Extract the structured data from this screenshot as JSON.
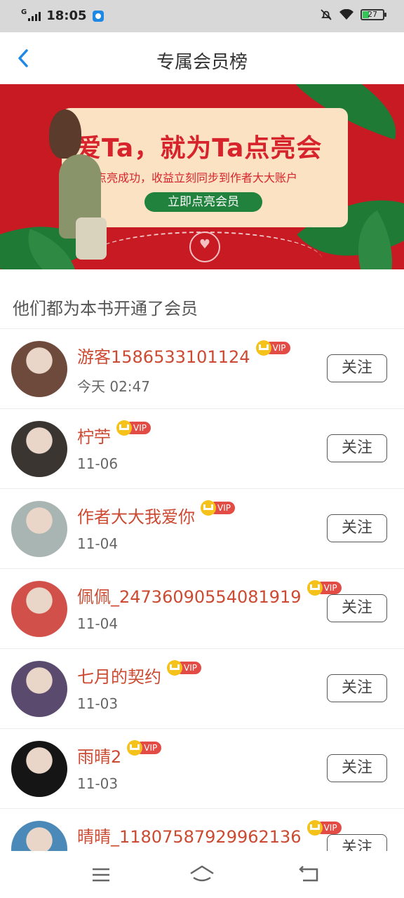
{
  "status_bar": {
    "time": "18:05",
    "signal_label": "G",
    "battery": "27"
  },
  "header": {
    "title": "专属会员榜"
  },
  "banner": {
    "headline": "爱Ta，就为Ta点亮会员",
    "subtitle": "点亮成功，收益立刻同步到作者大大账户",
    "button": "立即点亮会员"
  },
  "section": {
    "title": "他们都为本书开通了会员"
  },
  "members": [
    {
      "name": "游客1586533101124",
      "badge": "VIP",
      "time": "今天 02:47",
      "follow": "关注",
      "avatar_color": "#6d4a3b"
    },
    {
      "name": "柠苧",
      "badge": "VIP",
      "time": "11-06",
      "follow": "关注",
      "avatar_color": "#3a3530"
    },
    {
      "name": "作者大大我爱你",
      "badge": "VIP",
      "time": "11-04",
      "follow": "关注",
      "avatar_color": "#a9b5b2"
    },
    {
      "name": "佩佩_24736090554081919",
      "badge": "VIP",
      "time": "11-04",
      "follow": "关注",
      "avatar_color": "#d2504a"
    },
    {
      "name": "七月的契约",
      "badge": "VIP",
      "time": "11-03",
      "follow": "关注",
      "avatar_color": "#5a4a6e"
    },
    {
      "name": "雨晴2",
      "badge": "VIP",
      "time": "11-03",
      "follow": "关注",
      "avatar_color": "#151515"
    },
    {
      "name": "晴晴_11807587929962136",
      "badge": "VIP",
      "time": "",
      "follow": "关注",
      "avatar_color": "#4a89b8"
    }
  ],
  "colors": {
    "accent": "#cc4a32",
    "banner_bg": "#c71a22",
    "vip": "#e24c45",
    "crown": "#f4c21b"
  },
  "icons": {
    "back": "back-arrow-icon",
    "menu": "menu-icon",
    "home": "home-icon",
    "return": "return-icon"
  }
}
